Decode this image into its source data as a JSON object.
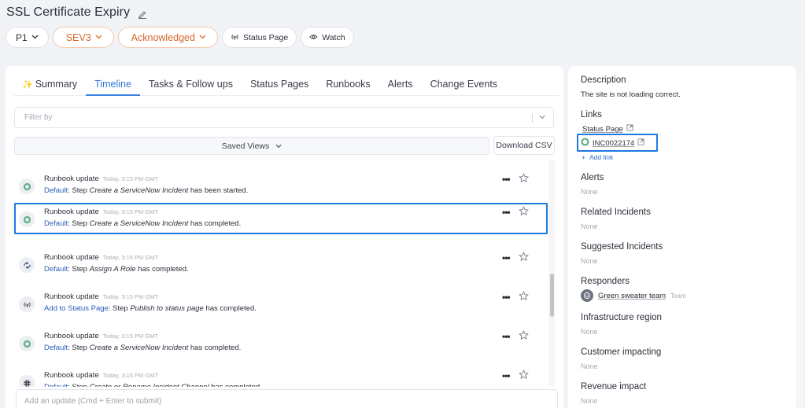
{
  "header": {
    "title": "SSL Certificate Expiry",
    "edit_icon": "pencil-icon",
    "pills": {
      "priority": "P1",
      "severity": "SEV3",
      "status": "Acknowledged",
      "status_page": "Status Page",
      "watch": "Watch"
    },
    "colors": {
      "accent_orange": "#d8672b",
      "accent_blue": "#2f7ad6",
      "highlight": "#1f7ae0"
    }
  },
  "tabs": [
    {
      "label": "Summary",
      "icon": "sparkle-icon",
      "active": false
    },
    {
      "label": "Timeline",
      "active": true
    },
    {
      "label": "Tasks & Follow ups",
      "active": false
    },
    {
      "label": "Status Pages",
      "active": false
    },
    {
      "label": "Runbooks",
      "active": false
    },
    {
      "label": "Alerts",
      "active": false
    },
    {
      "label": "Change Events",
      "active": false
    }
  ],
  "filter": {
    "placeholder": "Filter by"
  },
  "saved_views": {
    "label": "Saved Views"
  },
  "download_csv": {
    "label": "Download CSV"
  },
  "timeline": [
    {
      "icon": "servicenow-icon",
      "title": "Runbook update",
      "time": "Today, 3:15 PM GMT",
      "source": "Default",
      "pre": ": Step ",
      "step": "Create a ServiceNow Incident",
      "post": " has been started.",
      "highlighted": false
    },
    {
      "icon": "servicenow-icon",
      "title": "Runbook update",
      "time": "Today, 3:15 PM GMT",
      "source": "Default",
      "pre": ": Step ",
      "step": "Create a ServiceNow Incident",
      "post": " has completed.",
      "highlighted": true
    },
    {
      "icon": "refresh-arrows-icon",
      "title": "Runbook update",
      "time": "Today, 3:15 PM GMT",
      "source": "Default",
      "pre": ": Step ",
      "step": "Assign A Role",
      "post": " has completed.",
      "highlighted": false
    },
    {
      "icon": "broadcast-icon",
      "title": "Runbook update",
      "time": "Today, 3:15 PM GMT",
      "source": "Add to Status Page",
      "pre": ": Step ",
      "step": "Publish to status page",
      "post": " has completed.",
      "highlighted": false
    },
    {
      "icon": "servicenow-icon",
      "title": "Runbook update",
      "time": "Today, 3:15 PM GMT",
      "source": "Default",
      "pre": ": Step ",
      "step": "Create a ServiceNow Incident",
      "post": " has completed.",
      "highlighted": false
    },
    {
      "icon": "slack-icon",
      "title": "Runbook update",
      "time": "Today, 3:15 PM GMT",
      "source": "Default",
      "pre": ": Step ",
      "step": "Create or Rename Incident Channel",
      "post": " has completed.",
      "highlighted": false
    }
  ],
  "update_input": {
    "placeholder": "Add an update (Cmd + Enter to submit)"
  },
  "sidebar": {
    "description": {
      "label": "Description",
      "value": "The site is not loading correct."
    },
    "links": {
      "label": "Links",
      "items": [
        {
          "label": "Status Page",
          "icon": "external-link-icon"
        },
        {
          "label": "INC0022174",
          "icon": "external-link-icon",
          "logo": "servicenow-icon",
          "highlighted": true
        }
      ],
      "add_label": "Add link"
    },
    "alerts": {
      "label": "Alerts",
      "value": "None"
    },
    "related_incidents": {
      "label": "Related Incidents",
      "value": "None"
    },
    "suggested_incidents": {
      "label": "Suggested Incidents",
      "value": "None"
    },
    "responders": {
      "label": "Responders",
      "name": "Green sweater team",
      "type": "Team"
    },
    "infrastructure_region": {
      "label": "Infrastructure region",
      "value": "None"
    },
    "customer_impacting": {
      "label": "Customer impacting",
      "value": "None"
    },
    "revenue_impact": {
      "label": "Revenue impact",
      "value": "None"
    }
  }
}
